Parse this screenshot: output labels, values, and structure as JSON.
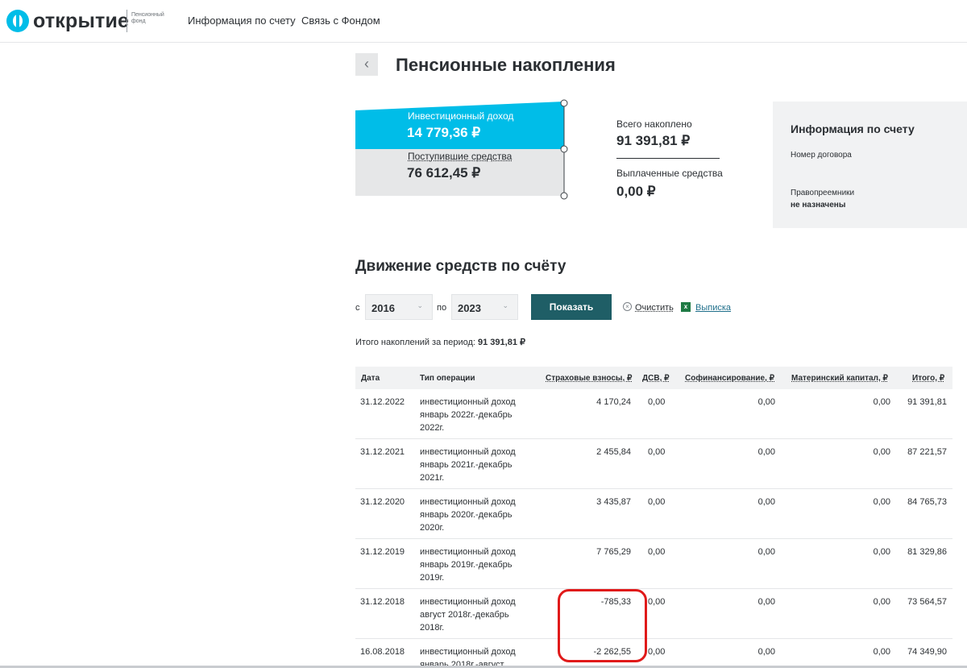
{
  "header": {
    "logo_text": "открытие",
    "logo_sub": "Пенсионный фонд",
    "nav": [
      "Информация по счету",
      "Связь с Фондом"
    ]
  },
  "page": {
    "back_icon": "chevron-left-icon",
    "title": "Пенсионные накопления"
  },
  "summary": {
    "investment_income_label": "Инвестиционный доход",
    "investment_income_value": "14 779,36 ₽",
    "received_funds_label": "Поступившие средства",
    "received_funds_value": "76 612,45 ₽",
    "total_label": "Всего накоплено",
    "total_value": "91 391,81 ₽",
    "paid_label": "Выплаченные средства",
    "paid_value": "0,00 ₽",
    "colors": {
      "income": "#00bde8",
      "received": "#e6e7e8"
    }
  },
  "info": {
    "title": "Информация по счету",
    "contract_label": "Номер договора",
    "successors_label": "Правопреемники",
    "successors_value": "не назначены"
  },
  "movement": {
    "title": "Движение средств по счёту",
    "from_label": "с",
    "from_value": "2016",
    "to_label": "по",
    "to_value": "2023",
    "show_button": "Показать",
    "clear_label": "Очистить",
    "export_label": "Выписка",
    "period_label": "Итого накоплений за период:",
    "period_value": "91 391,81 ₽"
  },
  "table": {
    "headers": [
      "Дата",
      "Тип операции",
      "Страховые взносы, ₽",
      "ДСВ, ₽",
      "Софинансирование, ₽",
      "Материнский капитал, ₽",
      "Итого, ₽"
    ],
    "rows": [
      {
        "date": "31.12.2022",
        "op": "инвестиционный доход январь 2022г.-декабрь 2022г.",
        "contrib": "4 170,24",
        "dsv": "0,00",
        "cofin": "0,00",
        "mat": "0,00",
        "total": "91 391,81"
      },
      {
        "date": "31.12.2021",
        "op": "инвестиционный доход январь 2021г.-декабрь 2021г.",
        "contrib": "2 455,84",
        "dsv": "0,00",
        "cofin": "0,00",
        "mat": "0,00",
        "total": "87 221,57"
      },
      {
        "date": "31.12.2020",
        "op": "инвестиционный доход январь 2020г.-декабрь 2020г.",
        "contrib": "3 435,87",
        "dsv": "0,00",
        "cofin": "0,00",
        "mat": "0,00",
        "total": "84 765,73"
      },
      {
        "date": "31.12.2019",
        "op": "инвестиционный доход январь 2019г.-декабрь 2019г.",
        "contrib": "7 765,29",
        "dsv": "0,00",
        "cofin": "0,00",
        "mat": "0,00",
        "total": "81 329,86"
      },
      {
        "date": "31.12.2018",
        "op": "инвестиционный доход август 2018г.-декабрь 2018г.",
        "contrib": "-785,33",
        "dsv": "0,00",
        "cofin": "0,00",
        "mat": "0,00",
        "total": "73 564,57"
      },
      {
        "date": "16.08.2018",
        "op": "инвестиционный доход январь 2018г.-август",
        "contrib": "-2 262,55",
        "dsv": "0,00",
        "cofin": "0,00",
        "mat": "0,00",
        "total": "74 349,90"
      }
    ]
  }
}
